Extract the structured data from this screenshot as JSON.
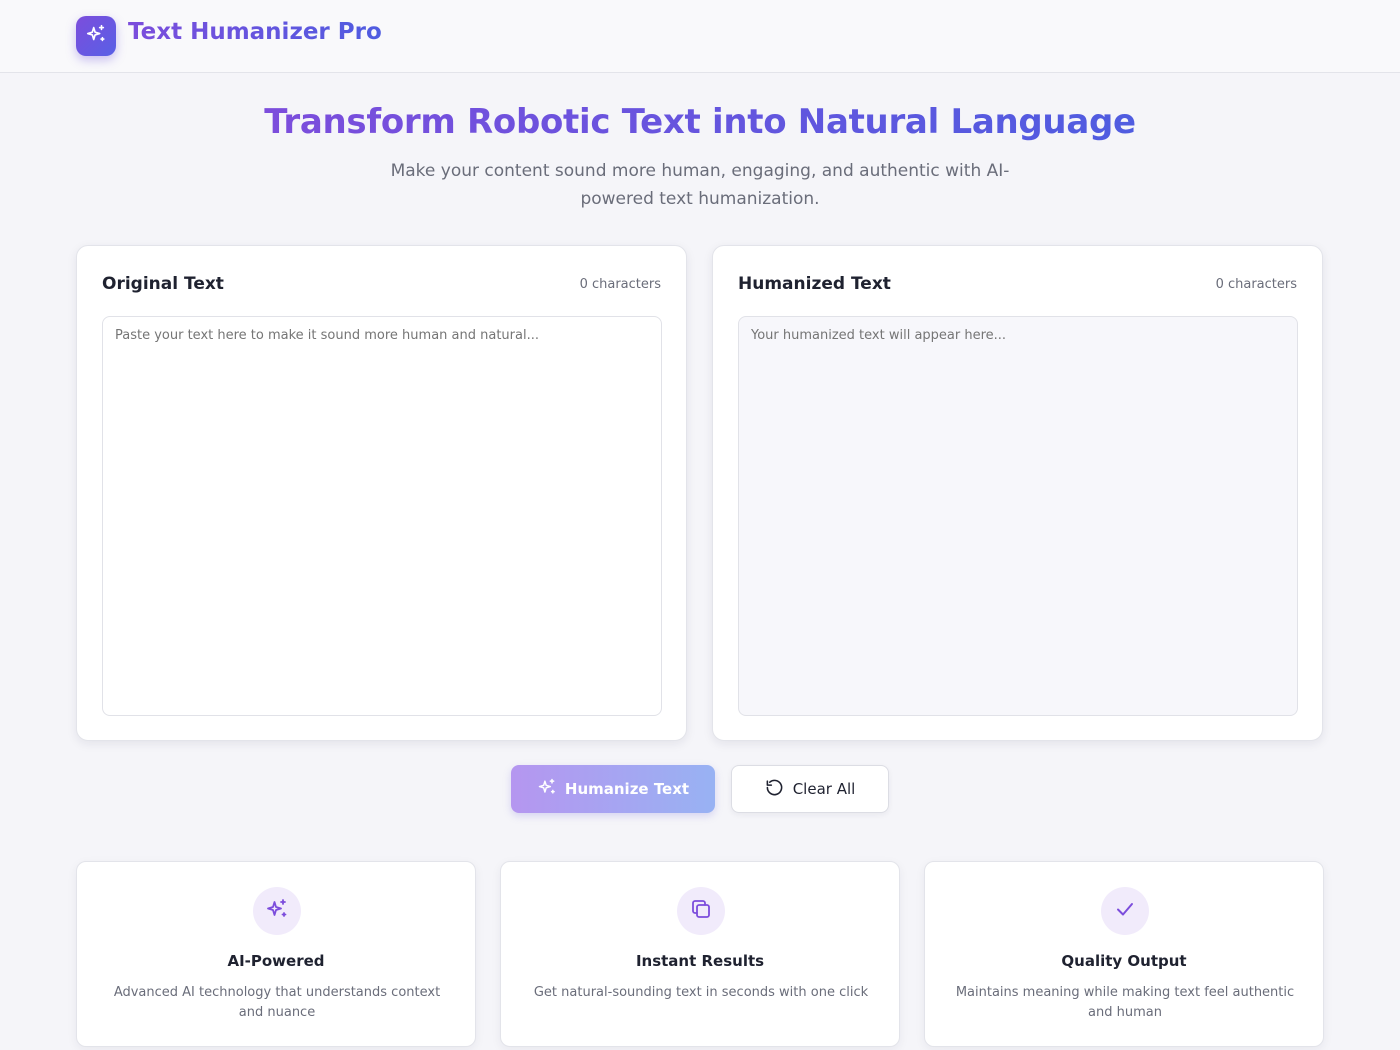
{
  "app": {
    "title": "Text Humanizer Pro",
    "logo_icon": "sparkles-icon",
    "accent_color": "#7c4ddc",
    "accent_color_2": "#4f5ce0"
  },
  "hero": {
    "title": "Transform Robotic Text into Natural Language",
    "subtitle": "Make your content sound more human, engaging, and authentic with AI-powered text humanization."
  },
  "original_panel": {
    "title": "Original Text",
    "count": "0 characters",
    "placeholder": "Paste your text here to make it sound more human and natural...",
    "value": ""
  },
  "humanized_panel": {
    "title": "Humanized Text",
    "count": "0 characters",
    "placeholder": "Your humanized text will appear here...",
    "value": ""
  },
  "actions": {
    "humanize_label": "Humanize Text",
    "humanize_icon": "sparkles-icon",
    "clear_label": "Clear All",
    "clear_icon": "rotate-ccw-icon"
  },
  "features": [
    {
      "icon": "sparkles-icon",
      "title": "AI-Powered",
      "description": "Advanced AI technology that understands context and nuance"
    },
    {
      "icon": "copy-icon",
      "title": "Instant Results",
      "description": "Get natural-sounding text in seconds with one click"
    },
    {
      "icon": "check-icon",
      "title": "Quality Output",
      "description": "Maintains meaning while making text feel authentic and human"
    }
  ]
}
